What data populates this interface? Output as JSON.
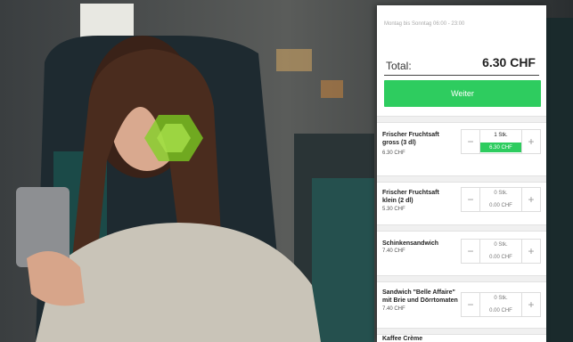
{
  "panel": {
    "top_note": "Montag bis Sonntag 06:00 - 23:00",
    "total_label": "Total:",
    "total_value": "6.30 CHF",
    "continue_label": "Weiter"
  },
  "items": [
    {
      "name": "Frischer Fruchtsaft\ngross (3 dl)",
      "price": "6.30 CHF",
      "qty": "1 Stk.",
      "subtotal": "6.30 CHF",
      "selected": true
    },
    {
      "name": "Frischer Fruchtsaft\nklein (2 dl)",
      "price": "5.30 CHF",
      "qty": "0 Stk.",
      "subtotal": "0.00 CHF",
      "selected": false
    },
    {
      "name": "Schinkensandwich",
      "price": "7.40 CHF",
      "qty": "0 Stk.",
      "subtotal": "0.00 CHF",
      "selected": false
    },
    {
      "name": "Sandwich \"Belle Affaire\"\nmit Brie und Dörrtomaten",
      "price": "7.40 CHF",
      "qty": "0 Stk.",
      "subtotal": "0.00 CHF",
      "selected": false
    },
    {
      "name": "Kaffee Crème",
      "price": "",
      "qty": "",
      "subtotal": "",
      "selected": false
    }
  ],
  "icons": {
    "minus": "−",
    "plus": "+"
  },
  "colors": {
    "accent": "#2ecc5f"
  }
}
